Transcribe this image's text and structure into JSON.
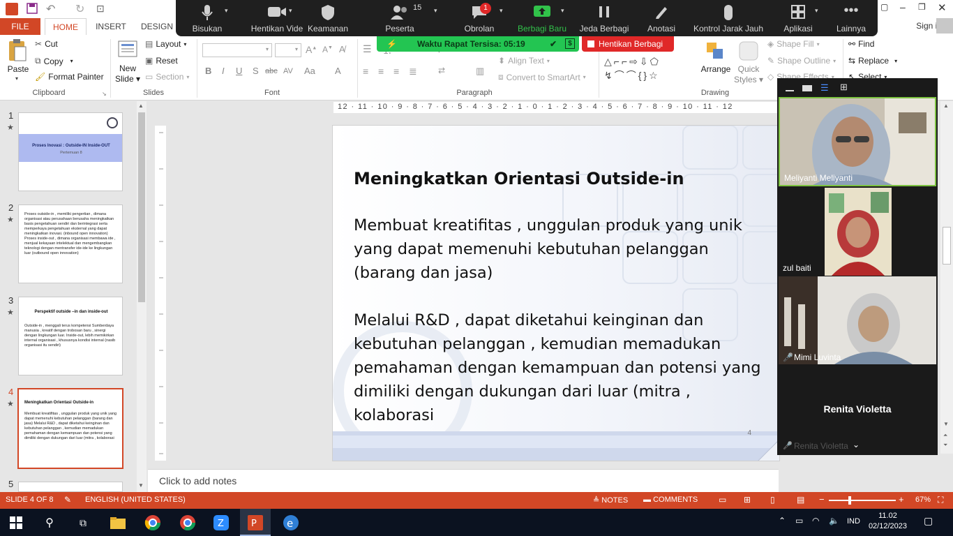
{
  "ribbon_tabs": {
    "file": "FILE",
    "home": "HOME",
    "insert": "INSERT",
    "design": "DESIGN",
    "sign_in": "Sign in"
  },
  "clipboard": {
    "paste": "Paste",
    "cut": "Cut",
    "copy": "Copy",
    "format_painter": "Format Painter",
    "label": "Clipboard"
  },
  "slides_group": {
    "new_slide_line1": "New",
    "new_slide_line2": "Slide",
    "layout": "Layout",
    "reset": "Reset",
    "section": "Section",
    "label": "Slides"
  },
  "font_group": {
    "label": "Font",
    "bold": "B",
    "italic": "I",
    "underline": "U",
    "shadow": "S",
    "strike": "abc",
    "spacing": "AV",
    "case": "Aa",
    "color": "A"
  },
  "paragraph_group": {
    "label": "Paragraph",
    "align_text": "Align Text",
    "convert_smartart": "Convert to SmartArt"
  },
  "drawing_group": {
    "label": "Drawing",
    "arrange": "Arrange",
    "quick_styles_line1": "Quick",
    "quick_styles_line2": "Styles",
    "shape_fill": "Shape Fill",
    "shape_outline": "Shape Outline",
    "shape_effects": "Shape Effects"
  },
  "editing_group": {
    "find": "Find",
    "replace": "Replace",
    "select": "Select"
  },
  "zoom_bar": {
    "items": [
      {
        "label": "Bisukan",
        "icon": "mic-icon"
      },
      {
        "label": "Hentikan Vide",
        "icon": "video-icon"
      },
      {
        "label": "Keamanan",
        "icon": "shield-icon"
      },
      {
        "label": "Peserta",
        "icon": "participants-icon",
        "count": "15"
      },
      {
        "label": "Obrolan",
        "icon": "chat-icon",
        "badge": "1"
      },
      {
        "label": "Berbagi Baru",
        "icon": "share-icon"
      },
      {
        "label": "Jeda Berbagi",
        "icon": "pause-icon"
      },
      {
        "label": "Anotasi",
        "icon": "pen-icon"
      },
      {
        "label": "Kontrol Jarak Jauh",
        "icon": "mouse-icon"
      },
      {
        "label": "Aplikasi",
        "icon": "apps-icon"
      },
      {
        "label": "Lainnya",
        "icon": "more-icon"
      }
    ],
    "timer_text": "Waktu Rapat Tersisa: 05:19",
    "stop_share": "Hentikan Berbagi",
    "accent_green": "#23c552",
    "accent_red": "#e02828"
  },
  "thumbnails": [
    {
      "num": "1",
      "title": "Proses Inovasi : Outside-IN Inside-OUT",
      "subtitle": "Pertemuan 8"
    },
    {
      "num": "2",
      "body": "Proses outside-in , memiliki pengertian , dimana organisasi atau perusahaan berusaha meningkatkan basis pengetahuan sendiri dan berintegrasi serta memperkaya pengetahuan eksternal yang dapat meningkatkan inovasi. (inbound open innovation) Proses inside-out , dimana organisasi membawa ide , menjual kekayaan intelektual dan mengembangkan teknologi dengan mentransfer ide-ide ke lingkungan luar (outbound open innovation)"
    },
    {
      "num": "3",
      "title": "Perspektif outside –in dan inside-out",
      "body": "Outside-in , menggali terus kompetensi Sumberdaya manusia , kreatif dengan trobosan baru , sinergi dengan lingkungan luar. Inside-out, lebih memikirkan internal organisasi , khususnya kondisi internal (nasib organisasi itu sendiri)"
    },
    {
      "num": "4",
      "title": "Meningkatkan Orientasi Outside-in",
      "body": "Membuat kreatifitas , unggulan produk yang unik yang dapat memenuhi kebutuhan pelanggan (barang dan jasa) Melalui R&D , dapat diketahui keinginan dan kebutuhan pelanggan , kemudian memadukan pemahaman dengan kemampuan dan potensi yang dimiliki dengan dukungan dari luar (mitra , kolaborasi"
    },
    {
      "num": "5"
    }
  ],
  "ruler": {
    "h_text": "12 · 11 · 10 · 9 · 8 · 7 · 6 · 5 · 4 · 3 · 2 · 1 · 0 · 1 · 2 · 3 · 4 · 5 · 6 · 7 · 8 · 9 · 10 · 11 · 12"
  },
  "slide": {
    "title": "Meningkatkan Orientasi Outside-in",
    "para1": "Membuat kreatifitas , unggulan  produk yang unik yang dapat memenuhi kebutuhan pelanggan (barang dan jasa)",
    "para2": "Melalui R&D , dapat diketahui keinginan dan kebutuhan pelanggan , kemudian memadukan pemahaman dengan kemampuan dan potensi yang dimiliki dengan dukungan dari luar  (mitra , kolaborasi",
    "number": "4"
  },
  "notes_placeholder": "Click to add notes",
  "video_panel": {
    "participants": [
      {
        "name": "Meliyanti Meliyanti"
      },
      {
        "name": "zul baiti"
      },
      {
        "name": "Mimi Luvinta"
      },
      {
        "name": "Renita Violetta"
      }
    ],
    "faded_name": "Renita Violetta"
  },
  "status_bar": {
    "slide_info": "SLIDE 4 OF 8",
    "language": "ENGLISH (UNITED STATES)",
    "notes": "NOTES",
    "comments": "COMMENTS",
    "zoom": "67%",
    "zoom_level": 0.67,
    "accent": "#d24726"
  },
  "taskbar": {
    "time": "11.02",
    "date": "02/12/2023",
    "lang": "IND"
  }
}
